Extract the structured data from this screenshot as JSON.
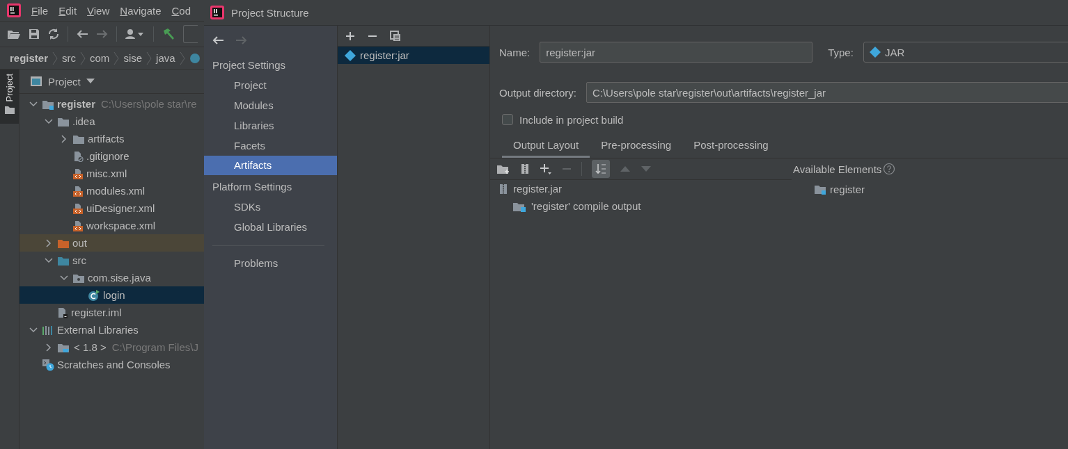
{
  "ide": {
    "menu": [
      "File",
      "Edit",
      "View",
      "Navigate",
      "Cod"
    ],
    "breadcrumb": [
      {
        "label": "register",
        "bold": true
      },
      {
        "label": "src",
        "bold": false
      },
      {
        "label": "com",
        "bold": false
      },
      {
        "label": "sise",
        "bold": false
      },
      {
        "label": "java",
        "bold": false
      }
    ],
    "side_tab": "Project",
    "panel_title": "Project",
    "tree": [
      {
        "label": "register",
        "kind": "module",
        "path": "C:\\Users\\pole star\\re",
        "expanded": true,
        "selected": false,
        "children": [
          {
            "label": ".idea",
            "kind": "folder",
            "expanded": true,
            "selected": false,
            "children": [
              {
                "label": "artifacts",
                "kind": "folder",
                "expanded": false,
                "selected": false
              },
              {
                "label": ".gitignore",
                "kind": "ignore",
                "selected": false
              },
              {
                "label": "misc.xml",
                "kind": "xml",
                "selected": false
              },
              {
                "label": "modules.xml",
                "kind": "xml",
                "selected": false
              },
              {
                "label": "uiDesigner.xml",
                "kind": "xml",
                "selected": false
              },
              {
                "label": "workspace.xml",
                "kind": "xml",
                "selected": false
              }
            ]
          },
          {
            "label": "out",
            "kind": "excluded",
            "expanded": false,
            "selected": false
          },
          {
            "label": "src",
            "kind": "source",
            "expanded": true,
            "selected": false,
            "children": [
              {
                "label": "com.sise.java",
                "kind": "package",
                "expanded": true,
                "selected": false,
                "children": [
                  {
                    "label": "login",
                    "kind": "class",
                    "selected": true
                  }
                ]
              }
            ]
          },
          {
            "label": "register.iml",
            "kind": "iml",
            "selected": false
          }
        ]
      },
      {
        "label": "External Libraries",
        "kind": "libraries",
        "expanded": true,
        "selected": false,
        "children": [
          {
            "label": "< 1.8 >",
            "kind": "jdk",
            "path": "C:\\Program Files\\J",
            "expanded": false,
            "selected": false
          }
        ]
      },
      {
        "label": "Scratches and Consoles",
        "kind": "scratches",
        "selected": false
      }
    ]
  },
  "dialog": {
    "title": "Project Structure",
    "nav": [
      {
        "kind": "header",
        "label": "Project Settings"
      },
      {
        "kind": "item",
        "label": "Project",
        "selected": false
      },
      {
        "kind": "item",
        "label": "Modules",
        "selected": false
      },
      {
        "kind": "item",
        "label": "Libraries",
        "selected": false
      },
      {
        "kind": "item",
        "label": "Facets",
        "selected": false
      },
      {
        "kind": "item",
        "label": "Artifacts",
        "selected": true
      },
      {
        "kind": "header",
        "label": "Platform Settings"
      },
      {
        "kind": "item",
        "label": "SDKs",
        "selected": false
      },
      {
        "kind": "item",
        "label": "Global Libraries",
        "selected": false
      },
      {
        "kind": "divider"
      },
      {
        "kind": "item",
        "label": "Problems",
        "selected": false
      }
    ],
    "artifacts": [
      {
        "label": "register:jar",
        "selected": true
      }
    ],
    "editor": {
      "name_label": "Name:",
      "name": "register:jar",
      "type_label": "Type:",
      "type": "JAR",
      "output_label": "Output directory:",
      "output_dir": "C:\\Users\\pole star\\register\\out\\artifacts\\register_jar",
      "include_label": "Include in project build",
      "include_checked": false,
      "tabs": [
        {
          "label": "Output Layout",
          "selected": true
        },
        {
          "label": "Pre-processing",
          "selected": false
        },
        {
          "label": "Post-processing",
          "selected": false
        }
      ],
      "sorted": true,
      "layout_tree": [
        {
          "label": "register.jar",
          "kind": "jar",
          "children": [
            {
              "label": "'register' compile output",
              "kind": "output"
            }
          ]
        }
      ],
      "available_title": "Available Elements",
      "available": [
        {
          "label": "register",
          "kind": "module"
        }
      ]
    }
  }
}
